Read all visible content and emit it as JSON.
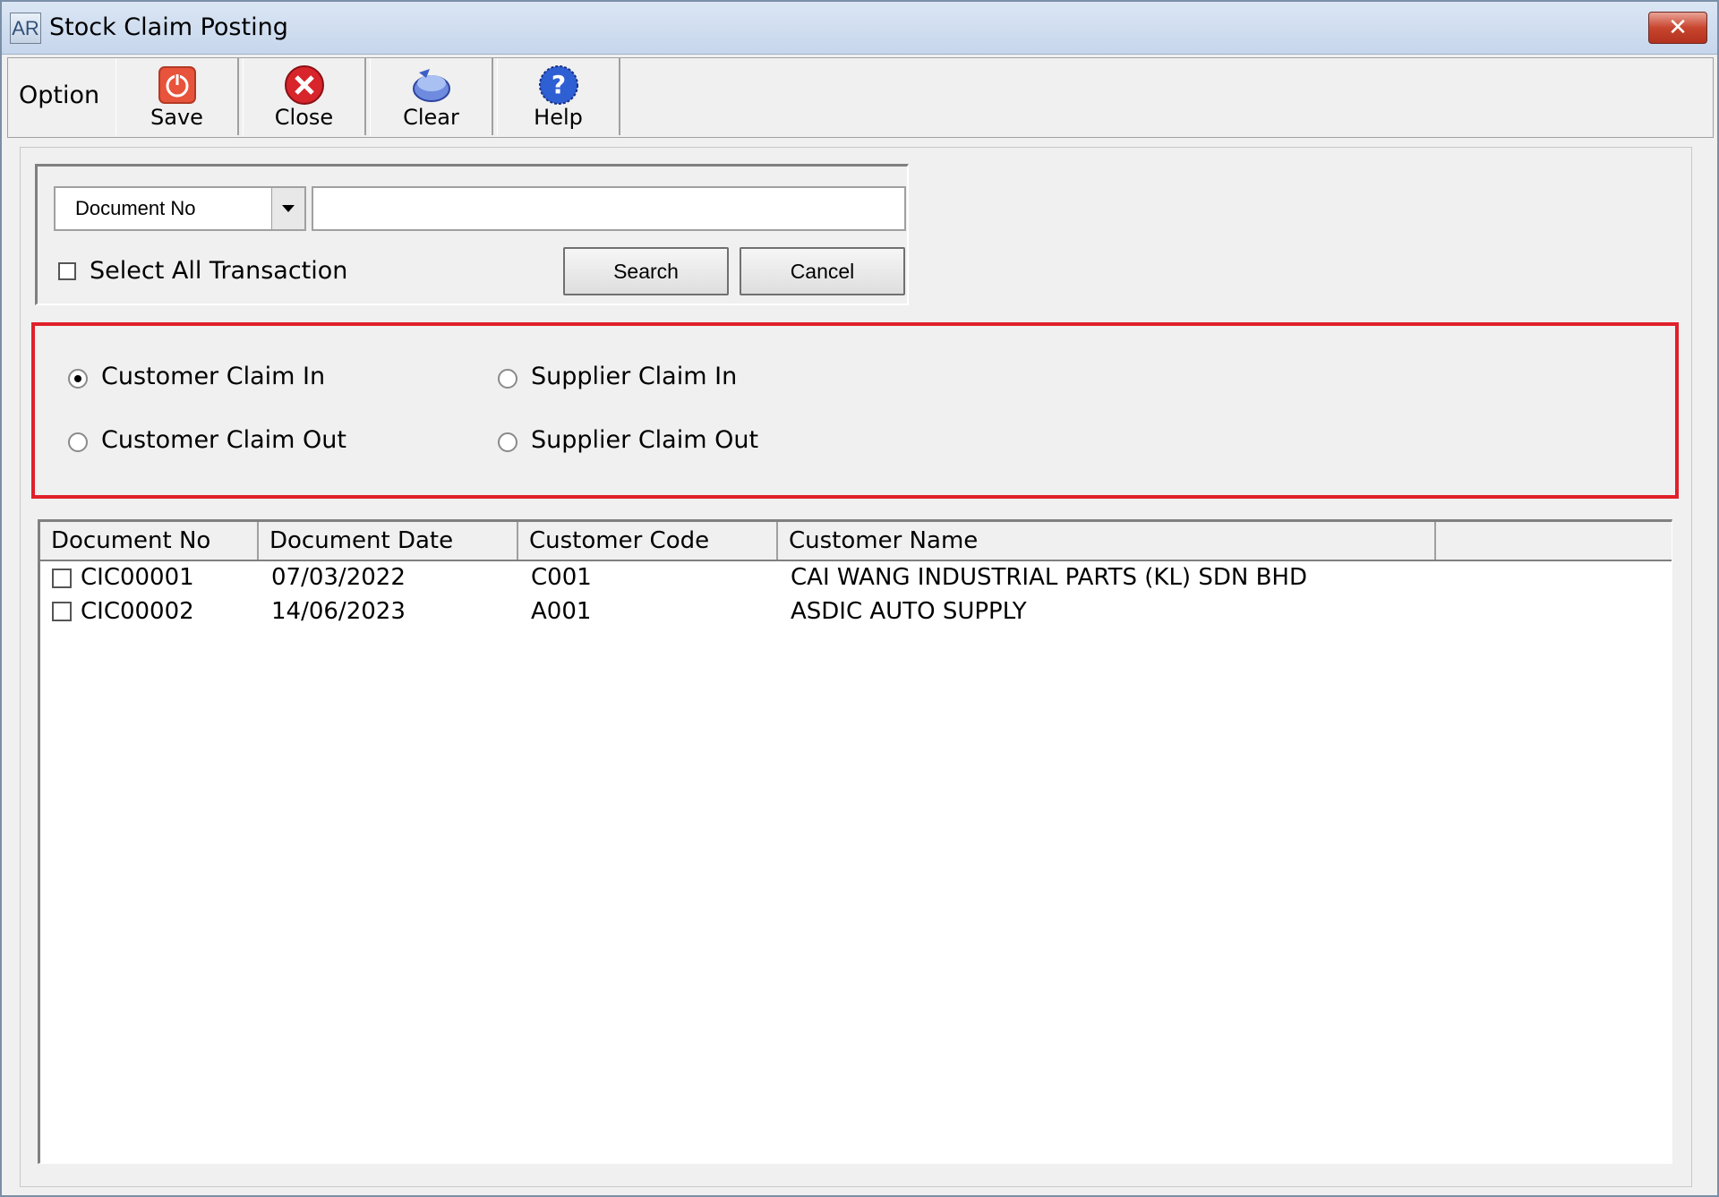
{
  "window": {
    "app_icon_text": "AR",
    "title": "Stock Claim Posting",
    "close_glyph": "✕"
  },
  "toolbar": {
    "group_label": "Option",
    "buttons": [
      {
        "label": "Save",
        "icon": "power-icon",
        "hotkey": "S"
      },
      {
        "label": "Close",
        "icon": "close-circle-icon",
        "hotkey": "C"
      },
      {
        "label": "Clear",
        "icon": "clear-icon",
        "hotkey": "l"
      },
      {
        "label": "Help",
        "icon": "help-icon",
        "hotkey": "H"
      }
    ]
  },
  "search": {
    "field_selected": "Document No",
    "query_value": "",
    "select_all_label": "Select All Transaction",
    "select_all_checked": false,
    "search_button": "Search",
    "cancel_button": "Cancel"
  },
  "claim_type": {
    "options": [
      {
        "label": "Customer Claim In",
        "checked": true
      },
      {
        "label": "Supplier Claim In",
        "checked": false
      },
      {
        "label": "Customer Claim Out",
        "checked": false
      },
      {
        "label": "Supplier Claim Out",
        "checked": false
      }
    ]
  },
  "grid": {
    "columns": [
      "Document No",
      "Document Date",
      "Customer Code",
      "Customer Name"
    ],
    "rows": [
      {
        "checked": false,
        "doc_no": "CIC00001",
        "date": "07/03/2022",
        "code": "C001",
        "name": "CAI WANG INDUSTRIAL PARTS (KL) SDN BHD"
      },
      {
        "checked": false,
        "doc_no": "CIC00002",
        "date": "14/06/2023",
        "code": "A001",
        "name": "ASDIC AUTO SUPPLY"
      }
    ]
  },
  "colors": {
    "highlight_border": "#e0202a",
    "titlebar": "#c6d6ec",
    "close_button": "#c8452f"
  }
}
